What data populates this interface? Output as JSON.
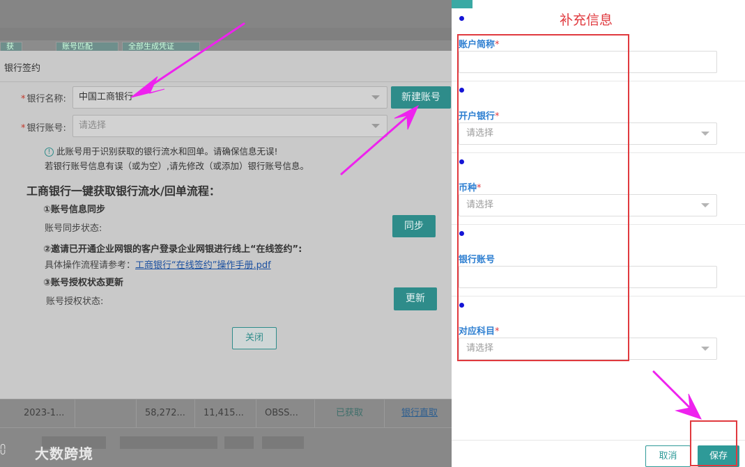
{
  "background": {
    "tabs": [
      "获取",
      "账号匹配",
      "全部生成凭证"
    ],
    "table_row": {
      "date": "2023-1...",
      "amount1": "58,272...",
      "amount2": "11,415...",
      "code": "OBSS...",
      "status": "已获取",
      "action": "银行直取"
    },
    "watermark": "大数跨境"
  },
  "dialog": {
    "title": "银行签约",
    "bank_name_label": "银行名称:",
    "bank_name_value": "中国工商银行",
    "new_account_button": "新建账号",
    "bank_account_label": "银行账号:",
    "bank_account_placeholder": "请选择",
    "note_line1": "此账号用于识别获取的银行流水和回单。请确保信息无误!",
    "note_line2": "若银行账号信息有误（或为空）,请先修改（或添加）银行账号信息。",
    "flow_title": "工商银行一键获取银行流水/回单流程：",
    "step1_title": "①账号信息同步",
    "step1_status_label": "账号同步状态:",
    "sync_button": "同步",
    "step2_title": "②邀请已开通企业网银的客户登录企业网银进行线上“在线签约”:",
    "step2_ref_label": "具体操作流程请参考：",
    "step2_link": "工商银行“在线签约”操作手册.pdf",
    "step3_title": "③账号授权状态更新",
    "step3_status_label": "账号授权状态:",
    "update_button": "更新",
    "close_button": "关闭"
  },
  "panel": {
    "title": "补充信息",
    "fields": [
      {
        "label": "账户简称",
        "required": "*",
        "type": "input",
        "value": ""
      },
      {
        "label": "开户银行",
        "required": "*",
        "type": "select",
        "placeholder": "请选择"
      },
      {
        "label": "币种",
        "required": "*",
        "type": "select",
        "placeholder": "请选择"
      },
      {
        "label": "银行账号",
        "required": "",
        "type": "input",
        "value": ""
      },
      {
        "label": "对应科目",
        "required": "*",
        "type": "select",
        "placeholder": "请选择"
      }
    ],
    "cancel_button": "取消",
    "save_button": "保存"
  },
  "colors": {
    "accent": "#2e9a98",
    "highlight_red": "#e0393e",
    "arrow_magenta": "#ee22ee"
  }
}
